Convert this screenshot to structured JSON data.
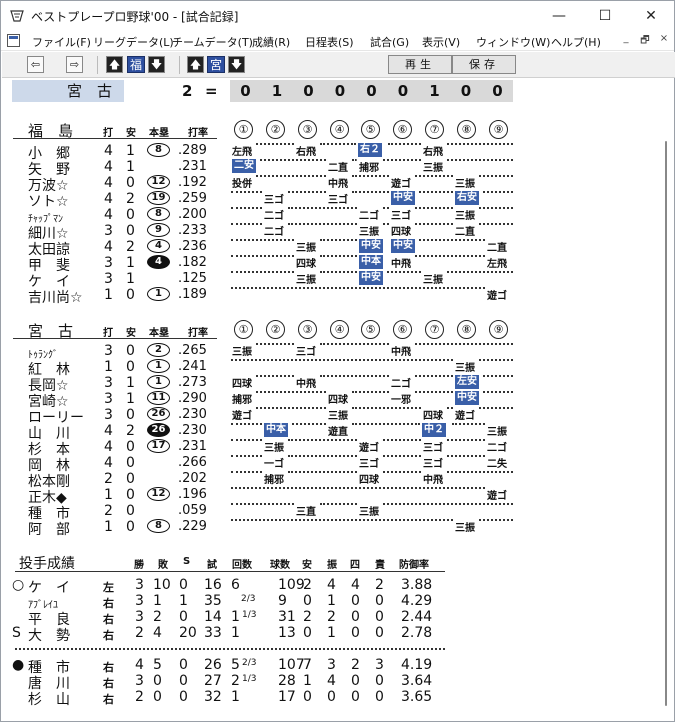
{
  "window": {
    "title": "ベストプレープロ野球'00 - [試合記録]",
    "min": "—",
    "max": "☐",
    "close": "✕"
  },
  "menu": [
    "ファイル(F)",
    "リーグデータ(L)",
    "チームデータ(T)",
    "成績(R)",
    "日程表(S)",
    "試合(G)",
    "表示(V)",
    "ウィンドウ(W)",
    "ヘルプ(H)"
  ],
  "menu_right": [
    "_",
    "🗗",
    "×"
  ],
  "toolbar": {
    "left": "⇦",
    "right": "⇨",
    "up": "🡅",
    "down": "🡇",
    "team1": "福",
    "team2": "宮",
    "play": "再生",
    "save": "保存"
  },
  "scoreboard": {
    "team": "宮　古",
    "runs": "2",
    "eq": "=",
    "innings": [
      "0",
      "1",
      "0",
      "0",
      "0",
      "0",
      "1",
      "0",
      "0"
    ]
  },
  "team1": {
    "name": "福　島",
    "headers": {
      "ab": "打",
      "h": "安",
      "hr": "本塁",
      "avg": "打率"
    },
    "inning_labels": [
      "①",
      "②",
      "③",
      "④",
      "⑤",
      "⑥",
      "⑦",
      "⑧",
      "⑨"
    ],
    "rows": [
      {
        "name": "小　郷",
        "ab": "4",
        "h": "1",
        "hr": "8",
        "avg": ".289",
        "hrf": false
      },
      {
        "name": "矢　野",
        "ab": "4",
        "h": "1",
        "hr": "",
        "avg": ".231"
      },
      {
        "name": "万波☆",
        "ab": "4",
        "h": "0",
        "hr": "12",
        "avg": ".192"
      },
      {
        "name": "ソト☆",
        "ab": "4",
        "h": "2",
        "hr": "19",
        "avg": ".259"
      },
      {
        "name": "ﾁｬｯﾌﾟﾏﾝ",
        "ab": "4",
        "h": "0",
        "hr": "8",
        "avg": ".200",
        "small": true
      },
      {
        "name": "細川☆",
        "ab": "3",
        "h": "0",
        "hr": "9",
        "avg": ".233"
      },
      {
        "name": "太田諒",
        "ab": "4",
        "h": "2",
        "hr": "4",
        "avg": ".236"
      },
      {
        "name": "甲　斐",
        "ab": "3",
        "h": "1",
        "hr": "4",
        "avg": ".182",
        "hrf": true
      },
      {
        "name": "ケ　イ",
        "ab": "3",
        "h": "1",
        "hr": "",
        "avg": ".125"
      },
      {
        "name": "吉川尚☆",
        "ab": "1",
        "h": "0",
        "hr": "1",
        "avg": ".189"
      }
    ],
    "plays": [
      [
        "左飛",
        "",
        "右飛",
        "",
        "右２",
        "",
        "右飛",
        "",
        ""
      ],
      [
        "二安",
        "",
        "",
        "二直",
        "捕邪",
        "",
        "三振",
        "",
        ""
      ],
      [
        "投併",
        "",
        "",
        "中飛",
        "",
        "遊ゴ",
        "",
        "三振",
        ""
      ],
      [
        "",
        "三ゴ",
        "",
        "三ゴ",
        "",
        "中安",
        "",
        "右安",
        ""
      ],
      [
        "",
        "二ゴ",
        "",
        "",
        "二ゴ",
        "三ゴ",
        "",
        "三振",
        ""
      ],
      [
        "",
        "二ゴ",
        "",
        "",
        "三振",
        "四球",
        "",
        "二直",
        ""
      ],
      [
        "",
        "",
        "三振",
        "",
        "中安",
        "中安",
        "",
        "",
        "二直"
      ],
      [
        "",
        "",
        "四球",
        "",
        "中本",
        "中飛",
        "",
        "",
        "左飛"
      ],
      [
        "",
        "",
        "三振",
        "",
        "中安",
        "",
        "三振",
        "",
        ""
      ],
      [
        "",
        "",
        "",
        "",
        "",
        "",
        "",
        "",
        "遊ゴ"
      ]
    ]
  },
  "team2": {
    "name": "宮　古",
    "headers": {
      "ab": "打",
      "h": "安",
      "hr": "本塁",
      "avg": "打率"
    },
    "rows": [
      {
        "name": "ﾄｩﾗﾝｸﾞ",
        "ab": "3",
        "h": "0",
        "hr": "2",
        "avg": ".265",
        "small": true
      },
      {
        "name": "紅　林",
        "ab": "1",
        "h": "0",
        "hr": "1",
        "avg": ".241"
      },
      {
        "name": "長岡☆",
        "ab": "3",
        "h": "1",
        "hr": "1",
        "avg": ".273"
      },
      {
        "name": "宮崎☆",
        "ab": "3",
        "h": "1",
        "hr": "11",
        "avg": ".290"
      },
      {
        "name": "ローリー",
        "ab": "3",
        "h": "0",
        "hr": "26",
        "avg": ".230"
      },
      {
        "name": "山　川",
        "ab": "4",
        "h": "2",
        "hr": "26",
        "avg": ".230",
        "hrf": true
      },
      {
        "name": "杉　本",
        "ab": "4",
        "h": "0",
        "hr": "17",
        "avg": ".231"
      },
      {
        "name": "岡　林",
        "ab": "4",
        "h": "0",
        "hr": "",
        "avg": ".266"
      },
      {
        "name": "松本剛",
        "ab": "2",
        "h": "0",
        "hr": "",
        "avg": ".202"
      },
      {
        "name": "正木◆",
        "ab": "1",
        "h": "0",
        "hr": "12",
        "avg": ".196"
      },
      {
        "name": "種　市",
        "ab": "2",
        "h": "0",
        "hr": "",
        "avg": ".059"
      },
      {
        "name": "阿　部",
        "ab": "1",
        "h": "0",
        "hr": "8",
        "avg": ".229"
      }
    ],
    "plays": [
      [
        "三振",
        "",
        "三ゴ",
        "",
        "",
        "中飛",
        "",
        "",
        ""
      ],
      [
        "",
        "",
        "",
        "",
        "",
        "",
        "",
        "三振",
        ""
      ],
      [
        "四球",
        "",
        "中飛",
        "",
        "",
        "二ゴ",
        "",
        "左安",
        ""
      ],
      [
        "捕邪",
        "",
        "",
        "四球",
        "",
        "一邪",
        "",
        "中安",
        ""
      ],
      [
        "遊ゴ",
        "",
        "",
        "三振",
        "",
        "",
        "四球",
        "遊ゴ",
        ""
      ],
      [
        "",
        "中本",
        "",
        "遊直",
        "",
        "",
        "中２",
        "",
        "三振"
      ],
      [
        "",
        "三振",
        "",
        "",
        "遊ゴ",
        "",
        "三ゴ",
        "",
        "二ゴ"
      ],
      [
        "",
        "一ゴ",
        "",
        "",
        "三ゴ",
        "",
        "三ゴ",
        "",
        "二失"
      ],
      [
        "",
        "捕邪",
        "",
        "",
        "四球",
        "",
        "中飛",
        "",
        ""
      ],
      [
        "",
        "",
        "",
        "",
        "",
        "",
        "",
        "",
        "遊ゴ"
      ],
      [
        "",
        "",
        "三直",
        "",
        "三振",
        "",
        "",
        "",
        ""
      ],
      [
        "",
        "",
        "",
        "",
        "",
        "",
        "",
        "三振",
        ""
      ]
    ]
  },
  "pitching": {
    "title": "投手成績",
    "headers": [
      "勝",
      "敗",
      "S",
      "試",
      "回数",
      "球数",
      "安",
      "振",
      "四",
      "責",
      "防御率"
    ],
    "team1": [
      {
        "mark": "○",
        "name": "ケ　イ",
        "hand": "左",
        "w": "3",
        "l": "10",
        "s": "0",
        "g": "16",
        "ip": "6",
        "ipf": "",
        "bp": "109",
        "h": "2",
        "k": "4",
        "bb": "4",
        "er": "2",
        "era": "3.88"
      },
      {
        "mark": "",
        "name": "ｱﾌﾞﾚｲﾕ",
        "hand": "右",
        "w": "3",
        "l": "1",
        "s": "1",
        "g": "35",
        "ip": "",
        "ipf": "2/3",
        "bp": "9",
        "h": "0",
        "k": "1",
        "bb": "0",
        "er": "0",
        "era": "4.29",
        "small": true
      },
      {
        "mark": "",
        "name": "平　良",
        "hand": "右",
        "w": "3",
        "l": "2",
        "s": "0",
        "g": "14",
        "ip": "1",
        "ipf": "1/3",
        "bp": "31",
        "h": "2",
        "k": "2",
        "bb": "0",
        "er": "0",
        "era": "2.44"
      },
      {
        "mark": "S",
        "name": "大　勢",
        "hand": "右",
        "w": "2",
        "l": "4",
        "s": "20",
        "g": "33",
        "ip": "1",
        "ipf": "",
        "bp": "13",
        "h": "0",
        "k": "1",
        "bb": "0",
        "er": "0",
        "era": "2.78"
      }
    ],
    "team2": [
      {
        "mark": "●",
        "name": "種　市",
        "hand": "右",
        "w": "4",
        "l": "5",
        "s": "0",
        "g": "26",
        "ip": "5",
        "ipf": "2/3",
        "bp": "107",
        "h": "7",
        "k": "3",
        "bb": "2",
        "er": "3",
        "era": "4.19"
      },
      {
        "mark": "",
        "name": "唐　川",
        "hand": "右",
        "w": "3",
        "l": "0",
        "s": "0",
        "g": "27",
        "ip": "2",
        "ipf": "1/3",
        "bp": "28",
        "h": "1",
        "k": "4",
        "bb": "0",
        "er": "0",
        "era": "3.64"
      },
      {
        "mark": "",
        "name": "杉　山",
        "hand": "右",
        "w": "2",
        "l": "0",
        "s": "0",
        "g": "32",
        "ip": "1",
        "ipf": "",
        "bp": "17",
        "h": "0",
        "k": "0",
        "bb": "0",
        "er": "0",
        "era": "3.65"
      }
    ]
  }
}
